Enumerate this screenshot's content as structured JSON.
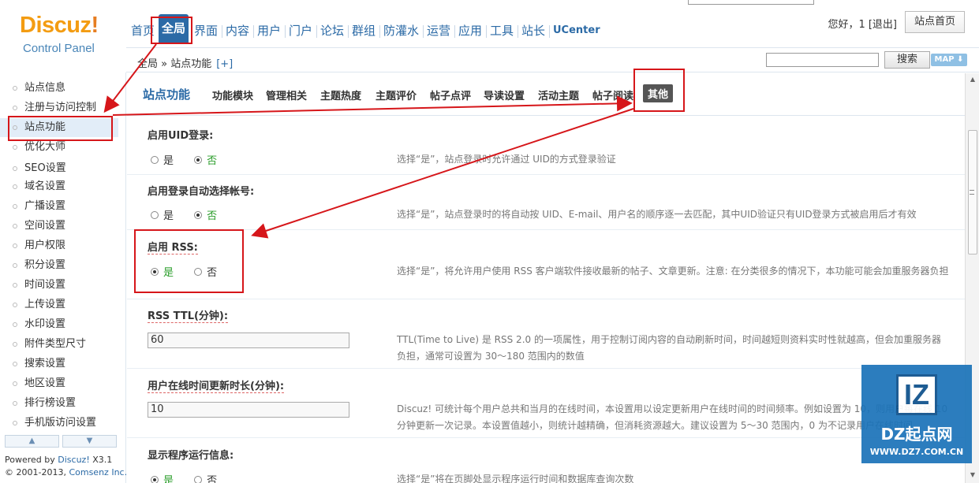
{
  "logo": {
    "brand": "Discuz",
    "bang": "!",
    "subtitle": "Control Panel"
  },
  "topnav": {
    "tabs": [
      "首页",
      "全局",
      "界面",
      "内容",
      "用户",
      "门户",
      "论坛",
      "群组",
      "防灌水",
      "运营",
      "应用",
      "工具",
      "站长",
      "UCenter"
    ],
    "active": "全局"
  },
  "header": {
    "greeting": "您好，1 [退出]",
    "home_label": "站点首页"
  },
  "crumbbar": {
    "crumb": "全局 » 站点功能",
    "plus": "[+]",
    "search_value": "",
    "search_label": "搜索",
    "map_label": "MAP ⬇"
  },
  "sidebar": {
    "items": [
      "站点信息",
      "注册与访问控制",
      "站点功能",
      "优化大师",
      "SEO设置",
      "域名设置",
      "广播设置",
      "空间设置",
      "用户权限",
      "积分设置",
      "时间设置",
      "上传设置",
      "水印设置",
      "附件类型尺寸",
      "搜索设置",
      "地区设置",
      "排行榜设置",
      "手机版访问设置"
    ],
    "active": "站点功能",
    "powered_prefix": "Powered by ",
    "powered_brand": "Discuz!",
    "powered_version": " X3.1",
    "copyright_prefix": "© 2001-2013, ",
    "copyright_link": "Comsenz Inc."
  },
  "main": {
    "section_title": "站点功能",
    "subtabs": [
      "功能模块",
      "管理相关",
      "主题热度",
      "主题评价",
      "帖子点评",
      "导读设置",
      "活动主题",
      "帖子阅读",
      "其他"
    ],
    "active_subtab": "其他",
    "settings": [
      {
        "label": "启用UID登录:",
        "yes": "是",
        "no": "否",
        "value": "no",
        "desc": "选择“是”，站点登录时允许通过 UID的方式登录验证"
      },
      {
        "label": "启用登录自动选择帐号:",
        "yes": "是",
        "no": "否",
        "value": "no",
        "desc": "选择“是”，站点登录时的将自动按 UID、E-mail、用户名的顺序逐一去匹配，其中UID验证只有UID登录方式被启用后才有效"
      },
      {
        "label": "启用 RSS:",
        "yes": "是",
        "no": "否",
        "value": "yes",
        "desc": "选择“是”，将允许用户使用 RSS 客户端软件接收最新的帖子、文章更新。注意: 在分类很多的情况下，本功能可能会加重服务器负担"
      },
      {
        "label": "RSS TTL(分钟):",
        "input": "60",
        "desc": "TTL(Time to Live) 是 RSS 2.0 的一项属性，用于控制订阅内容的自动刷新时间，时间越短则资料实时性就越高，但会加重服务器负担，通常可设置为 30～180 范围内的数值"
      },
      {
        "label": "用户在线时间更新时长(分钟):",
        "input": "10",
        "desc": "Discuz! 可统计每个用户总共和当月的在线时间，本设置用以设定更新用户在线时间的时间频率。例如设置为 10，则用户每在线 10 分钟更新一次记录。本设置值越小，则统计越精确，但消耗资源越大。建议设置为 5～30 范围内，0 为不记录用户在线时间"
      },
      {
        "label": "显示程序运行信息:",
        "yes": "是",
        "no": "否",
        "value": "yes",
        "desc": "选择“是”将在页脚处显示程序运行时间和数据库查询次数"
      }
    ]
  },
  "watermark": {
    "logo": "IZ",
    "brand": "DZ起点网",
    "url": "WWW.DZ7.COM.CN"
  }
}
